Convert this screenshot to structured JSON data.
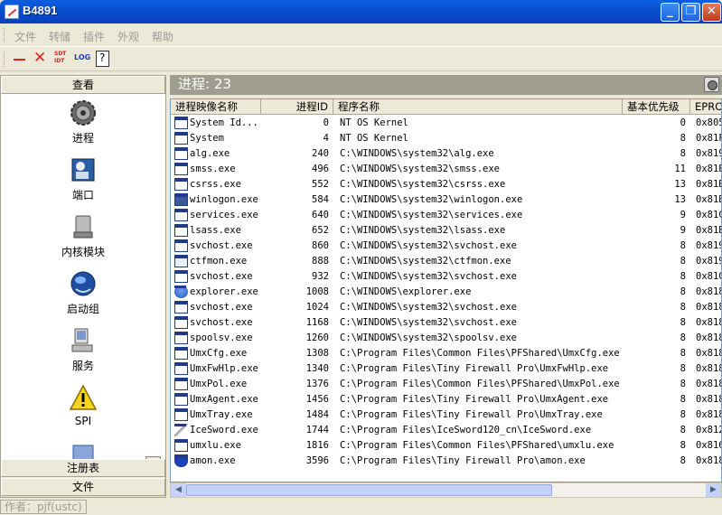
{
  "window": {
    "title": "B4891"
  },
  "menu": [
    "文件",
    "转储",
    "插件",
    "外观",
    "帮助"
  ],
  "toolbar": {
    "sdt_label_top": "SDT",
    "sdt_label_bottom": "IDT",
    "log_label": "LOG",
    "help_label": "?"
  },
  "sidebar": {
    "header_view": "查看",
    "items": [
      {
        "label": "进程",
        "icon": "gear-icon"
      },
      {
        "label": "端口",
        "icon": "network-port-icon"
      },
      {
        "label": "内核模块",
        "icon": "drive-icon"
      },
      {
        "label": "启动组",
        "icon": "globe-icon"
      },
      {
        "label": "服务",
        "icon": "computer-icon"
      },
      {
        "label": "SPI",
        "icon": "warning-icon"
      }
    ],
    "footer_registry": "注册表",
    "footer_file": "文件"
  },
  "process_panel": {
    "title": "进程: 23",
    "columns": [
      "进程映像名称",
      "进程ID",
      "程序名称",
      "基本优先级",
      "EPROCESS"
    ],
    "rows": [
      {
        "name": "System Id...",
        "pid": "0",
        "path": "NT OS Kernel",
        "priority": "0",
        "eprocess": "0x805",
        "icon": "generic"
      },
      {
        "name": "System",
        "pid": "4",
        "path": "NT OS Kernel",
        "priority": "8",
        "eprocess": "0x81F",
        "icon": "generic"
      },
      {
        "name": "alg.exe",
        "pid": "240",
        "path": "C:\\WINDOWS\\system32\\alg.exe",
        "priority": "8",
        "eprocess": "0x819",
        "icon": "generic"
      },
      {
        "name": "smss.exe",
        "pid": "496",
        "path": "C:\\WINDOWS\\system32\\smss.exe",
        "priority": "11",
        "eprocess": "0x81E",
        "icon": "generic"
      },
      {
        "name": "csrss.exe",
        "pid": "552",
        "path": "C:\\WINDOWS\\system32\\csrss.exe",
        "priority": "13",
        "eprocess": "0x81B",
        "icon": "generic"
      },
      {
        "name": "winlogon.exe",
        "pid": "584",
        "path": "C:\\WINDOWS\\system32\\winlogon.exe",
        "priority": "13",
        "eprocess": "0x81B",
        "icon": "winlogon"
      },
      {
        "name": "services.exe",
        "pid": "640",
        "path": "C:\\WINDOWS\\system32\\services.exe",
        "priority": "9",
        "eprocess": "0x81C",
        "icon": "generic"
      },
      {
        "name": "lsass.exe",
        "pid": "652",
        "path": "C:\\WINDOWS\\system32\\lsass.exe",
        "priority": "9",
        "eprocess": "0x81B",
        "icon": "generic"
      },
      {
        "name": "svchost.exe",
        "pid": "860",
        "path": "C:\\WINDOWS\\system32\\svchost.exe",
        "priority": "8",
        "eprocess": "0x819",
        "icon": "generic"
      },
      {
        "name": "ctfmon.exe",
        "pid": "888",
        "path": "C:\\WINDOWS\\system32\\ctfmon.exe",
        "priority": "8",
        "eprocess": "0x819",
        "icon": "pen"
      },
      {
        "name": "svchost.exe",
        "pid": "932",
        "path": "C:\\WINDOWS\\system32\\svchost.exe",
        "priority": "8",
        "eprocess": "0x81C",
        "icon": "generic"
      },
      {
        "name": "explorer.exe",
        "pid": "1008",
        "path": "C:\\WINDOWS\\explorer.exe",
        "priority": "8",
        "eprocess": "0x818",
        "icon": "explorer"
      },
      {
        "name": "svchost.exe",
        "pid": "1024",
        "path": "C:\\WINDOWS\\system32\\svchost.exe",
        "priority": "8",
        "eprocess": "0x818",
        "icon": "generic"
      },
      {
        "name": "svchost.exe",
        "pid": "1168",
        "path": "C:\\WINDOWS\\system32\\svchost.exe",
        "priority": "8",
        "eprocess": "0x818",
        "icon": "generic"
      },
      {
        "name": "spoolsv.exe",
        "pid": "1260",
        "path": "C:\\WINDOWS\\system32\\spoolsv.exe",
        "priority": "8",
        "eprocess": "0x818",
        "icon": "generic"
      },
      {
        "name": "UmxCfg.exe",
        "pid": "1308",
        "path": "C:\\Program Files\\Common Files\\PFShared\\UmxCfg.exe",
        "priority": "8",
        "eprocess": "0x818",
        "icon": "generic"
      },
      {
        "name": "UmxFwHlp.exe",
        "pid": "1340",
        "path": "C:\\Program Files\\Tiny Firewall Pro\\UmxFwHlp.exe",
        "priority": "8",
        "eprocess": "0x818",
        "icon": "generic"
      },
      {
        "name": "UmxPol.exe",
        "pid": "1376",
        "path": "C:\\Program Files\\Common Files\\PFShared\\UmxPol.exe",
        "priority": "8",
        "eprocess": "0x818",
        "icon": "generic"
      },
      {
        "name": "UmxAgent.exe",
        "pid": "1456",
        "path": "C:\\Program Files\\Tiny Firewall Pro\\UmxAgent.exe",
        "priority": "8",
        "eprocess": "0x818",
        "icon": "generic"
      },
      {
        "name": "UmxTray.exe",
        "pid": "1484",
        "path": "C:\\Program Files\\Tiny Firewall Pro\\UmxTray.exe",
        "priority": "8",
        "eprocess": "0x818",
        "icon": "generic"
      },
      {
        "name": "IceSword.exe",
        "pid": "1744",
        "path": "C:\\Program Files\\IceSword120_cn\\IceSword.exe",
        "priority": "8",
        "eprocess": "0x812",
        "icon": "sword"
      },
      {
        "name": "umxlu.exe",
        "pid": "1816",
        "path": "C:\\Program Files\\Common Files\\PFShared\\umxlu.exe",
        "priority": "8",
        "eprocess": "0x816",
        "icon": "generic"
      },
      {
        "name": "amon.exe",
        "pid": "3596",
        "path": "C:\\Program Files\\Tiny Firewall Pro\\amon.exe",
        "priority": "8",
        "eprocess": "0x818",
        "icon": "shield"
      }
    ]
  },
  "status": {
    "author": "作者：pjf(ustc)"
  }
}
